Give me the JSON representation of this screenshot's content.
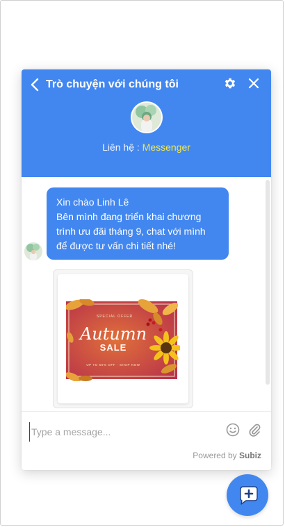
{
  "header": {
    "title": "Trò chuyện với chúng tôi",
    "contact_prefix": "Liên hệ : ",
    "contact_link": "Messenger"
  },
  "message": {
    "lines": [
      "Xin chào Linh Lê",
      "Bên mình đang triển khai chương",
      "trình ưu đãi tháng 9, chat với mình",
      "để được tư vấn chi tiết nhé!"
    ]
  },
  "promo": {
    "top_text": "SPECIAL OFFER",
    "script_text": "Autumn",
    "sale_text": "SALE",
    "bottom_text": "UP TO 50% OFF · SHOP NOW"
  },
  "composer": {
    "placeholder": "Type a message...",
    "value": "",
    "powered_prefix": "Powered by ",
    "powered_brand": "Subiz"
  },
  "colors": {
    "accent": "#4287f0",
    "link": "#f5e94a"
  },
  "icons": [
    "back-arrow-icon",
    "gear-icon",
    "close-icon",
    "smile-icon",
    "paperclip-icon",
    "chat-plus-icon"
  ]
}
